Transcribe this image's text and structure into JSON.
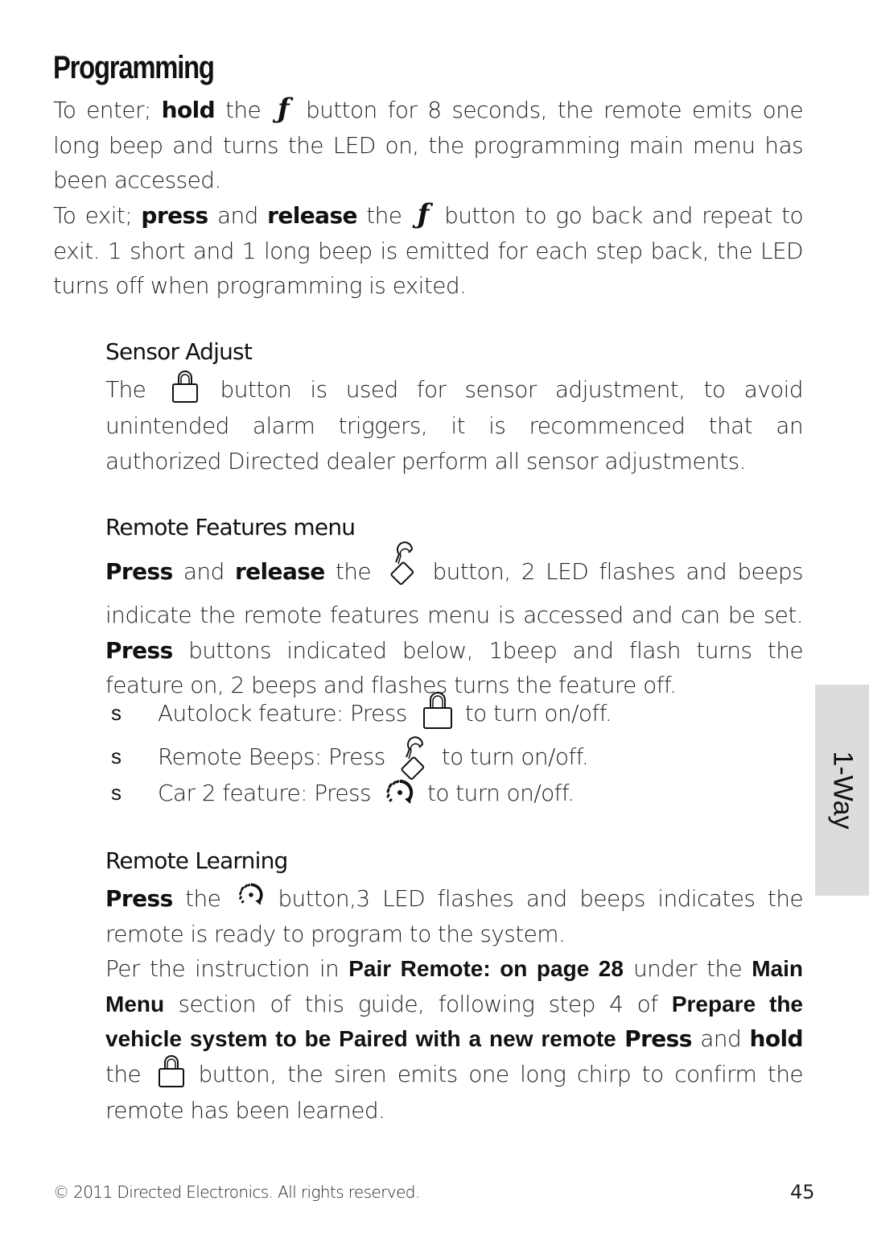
{
  "page": {
    "title": "Programming",
    "intro": {
      "enter_prefix": "To enter;",
      "enter_bold": "hold",
      "enter_the": "the",
      "enter_icon": "f-function-icon",
      "enter_rest": "button for 8 seconds, the remote emits one long beep and turns the LED on, the programming main menu has been accessed.",
      "exit_prefix": "To exit;",
      "exit_bold1": "press",
      "exit_and": "and",
      "exit_bold2": "release",
      "exit_the": "the",
      "exit_icon": "f-function-icon",
      "exit_rest": "button to go back and repeat to exit. 1 short and 1 long beep is emitted for each step back, the LED turns off when programming is exited.",
      "f_glyph": "ƒ"
    },
    "sensor_adjust": {
      "heading": "Sensor Adjust",
      "text_prefix": "The",
      "icon": "lock-icon",
      "text_rest": "button is used for sensor adjustment, to avoid unintended alarm triggers, it is recommenced that an authorized Directed dealer perform all sensor adjustments."
    },
    "remote_features": {
      "heading": "Remote Features menu",
      "bold1": "Press",
      "and": "and",
      "bold2": "release",
      "the": "the",
      "icon": "unlock-icon",
      "text1": "button, 2 LED flashes and beeps indicate the remote features menu is accessed and can be set.",
      "bold3": "Press",
      "text2": "buttons indicated below, 1beep and flash turns the feature on, 2 beeps and flashes turns the feature off.",
      "bullets": [
        {
          "mark": "s",
          "label": "Autolock feature: Press",
          "icon": "lock-icon",
          "suffix": "to turn on/off."
        },
        {
          "mark": "s",
          "label": "Remote Beeps: Press",
          "icon": "unlock-icon",
          "suffix": "to turn on/off."
        },
        {
          "mark": "s",
          "label": "Car 2 feature: Press",
          "icon": "car2-rotate-icon",
          "suffix": "to turn on/off."
        }
      ]
    },
    "remote_learning": {
      "heading": "Remote Learning",
      "bold1": "Press",
      "the": "the",
      "icon": "car2-rotate-icon",
      "text1": "button,3 LED flashes and beeps indicates the remote is ready to program to the system.",
      "per_text": "Per the instruction in",
      "link1": "Pair Remote:  on page 28",
      "under_the": "under the",
      "link2": "Main Menu",
      "section_text": "section of this guide, following step 4 of",
      "link3": "Prepare the vehicle system to be Paired with a new remote",
      "bold2": "Press",
      "and": "and",
      "bold3": "hold",
      "the2": "the",
      "icon2": "lock-icon",
      "text2": "button, the siren emits one long chirp to confirm the remote has been learned."
    },
    "side_tab": {
      "label": "1-Way"
    },
    "footer": {
      "copyright": "© 2011 Directed Electronics. All rights reserved.",
      "page_number": "45"
    }
  }
}
